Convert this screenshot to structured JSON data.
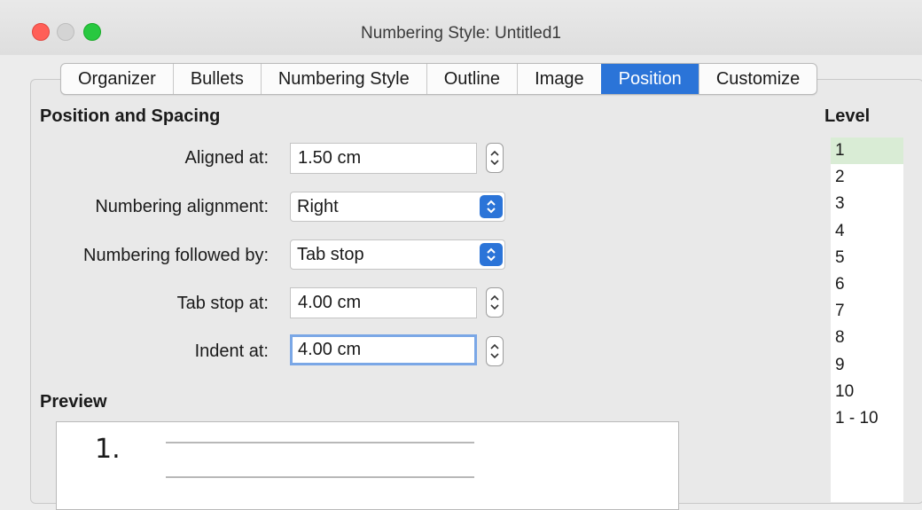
{
  "window": {
    "title": "Numbering Style: Untitled1"
  },
  "tabs": [
    {
      "label": "Organizer"
    },
    {
      "label": "Bullets"
    },
    {
      "label": "Numbering Style"
    },
    {
      "label": "Outline"
    },
    {
      "label": "Image"
    },
    {
      "label": "Position"
    },
    {
      "label": "Customize"
    }
  ],
  "active_tab": "Position",
  "position_spacing": {
    "title": "Position and Spacing",
    "aligned_at": {
      "label": "Aligned at:",
      "value": "1.50 cm"
    },
    "numbering_alignment": {
      "label": "Numbering alignment:",
      "value": "Right"
    },
    "numbering_followed_by": {
      "label": "Numbering followed by:",
      "value": "Tab stop"
    },
    "tab_stop_at": {
      "label": "Tab stop at:",
      "value": "4.00 cm"
    },
    "indent_at": {
      "label": "Indent at:",
      "value": "4.00 cm"
    }
  },
  "level": {
    "title": "Level",
    "items": [
      "1",
      "2",
      "3",
      "4",
      "5",
      "6",
      "7",
      "8",
      "9",
      "10",
      "1 - 10"
    ],
    "selected": "1"
  },
  "preview": {
    "title": "Preview",
    "number": "1."
  },
  "colors": {
    "accent": "#2b74d8",
    "level_selected": "#d9ecd5",
    "focus_ring": "#7aa7e6"
  }
}
